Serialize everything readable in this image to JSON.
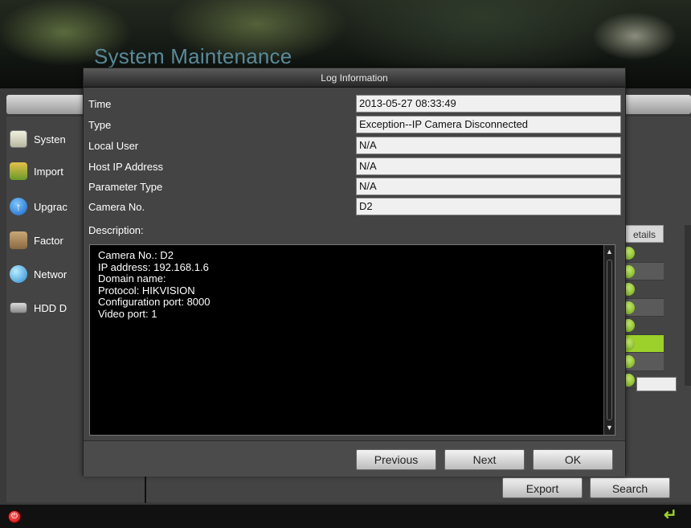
{
  "app": {
    "title": "System Maintenance"
  },
  "sidebar": {
    "items": [
      {
        "label": "Systen",
        "icon": "system-info-icon"
      },
      {
        "label": "Import",
        "icon": "import-export-icon"
      },
      {
        "label": "Upgrac",
        "icon": "upgrade-icon"
      },
      {
        "label": "Factor",
        "icon": "factory-default-icon"
      },
      {
        "label": "Networ",
        "icon": "network-icon"
      },
      {
        "label": "HDD D",
        "icon": "hdd-icon"
      }
    ]
  },
  "log_table": {
    "header_partial": "etails",
    "selected_row": 6
  },
  "footer_buttons": {
    "export": "Export",
    "search": "Search"
  },
  "dialog": {
    "title": "Log Information",
    "fields": [
      {
        "label": "Time",
        "value": "2013-05-27 08:33:49"
      },
      {
        "label": "Type",
        "value": "Exception--IP Camera Disconnected"
      },
      {
        "label": "Local User",
        "value": "N/A"
      },
      {
        "label": "Host IP Address",
        "value": "N/A"
      },
      {
        "label": "Parameter Type",
        "value": "N/A"
      },
      {
        "label": "Camera No.",
        "value": "D2"
      }
    ],
    "description_label": "Description:",
    "description_lines": [
      "Camera No.: D2",
      "IP address: 192.168.1.6",
      "Domain name:",
      "Protocol: HIKVISION",
      "Configuration port: 8000",
      "Video port: 1"
    ],
    "buttons": {
      "previous": "Previous",
      "next": "Next",
      "ok": "OK"
    }
  },
  "colors": {
    "accent_green": "#9bd12a",
    "title_blue": "#5a8a99",
    "dialog_bg": "#444444"
  }
}
